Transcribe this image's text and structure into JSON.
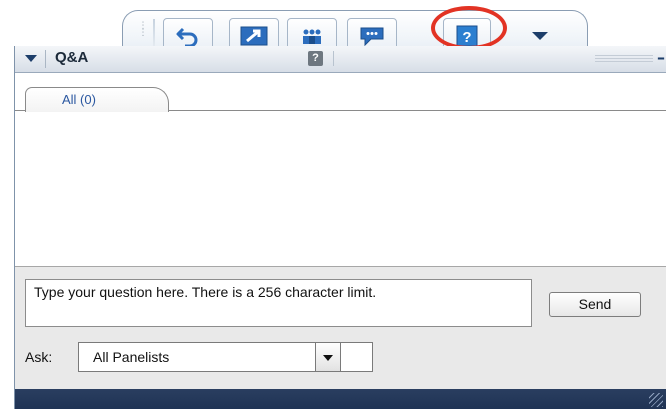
{
  "toolbar": {
    "buttons": [
      {
        "icon": "undo-arrow-icon"
      },
      {
        "icon": "share-icon"
      },
      {
        "icon": "participants-icon"
      },
      {
        "icon": "chat-icon"
      },
      {
        "icon": "qa-help-icon"
      },
      {
        "icon": "more-dropdown-icon"
      }
    ]
  },
  "panel": {
    "title": "Q&A",
    "help_glyph": "?",
    "minimize_glyph": "–",
    "tabs": [
      {
        "label": "All (0)"
      }
    ]
  },
  "compose": {
    "placeholder": "Type your question here. There is a 256 character limit.",
    "send_label": "Send",
    "ask_label": "Ask:",
    "ask_selected": "All Panelists"
  },
  "colors": {
    "highlight": "#e23324",
    "status_bar": "#1f3354",
    "tab_text": "#2a57a0"
  }
}
